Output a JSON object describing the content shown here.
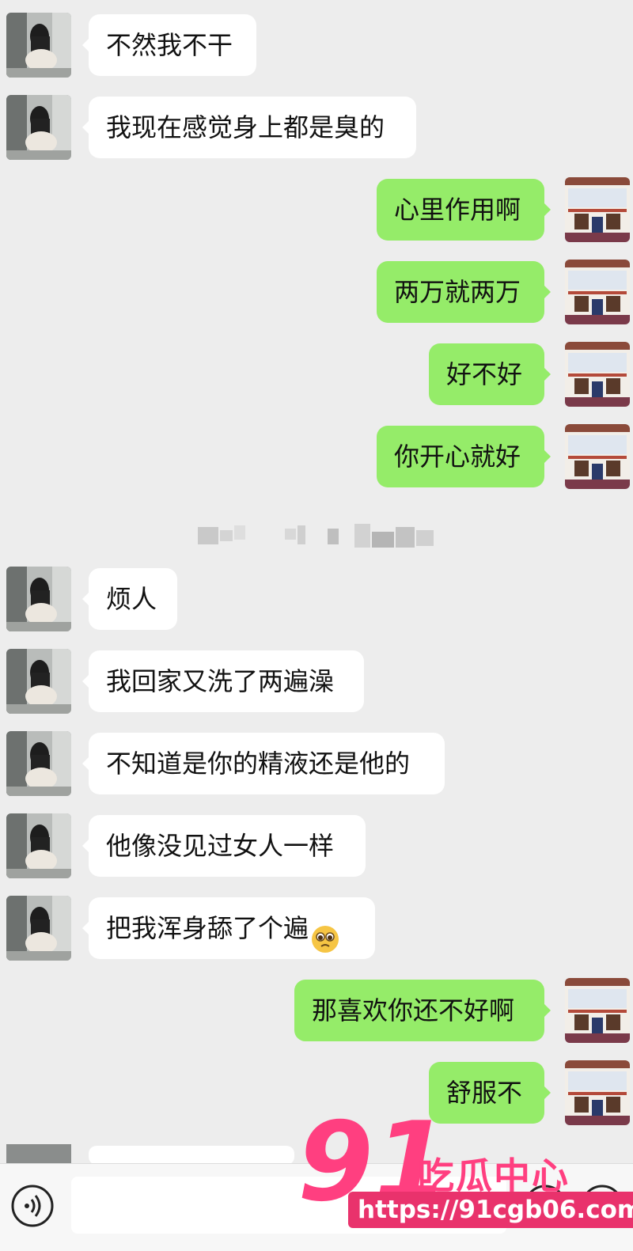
{
  "messages": [
    {
      "side": "left",
      "text": "不然我不干"
    },
    {
      "side": "left",
      "text": "我现在感觉身上都是臭的"
    },
    {
      "side": "right",
      "text": "心里作用啊"
    },
    {
      "side": "right",
      "text": "两万就两万"
    },
    {
      "side": "right",
      "text": "好不好"
    },
    {
      "side": "right",
      "text": "你开心就好"
    },
    {
      "side": "left",
      "text": "烦人"
    },
    {
      "side": "left",
      "text": "我回家又洗了两遍澡"
    },
    {
      "side": "left",
      "text": "不知道是你的精液还是他的"
    },
    {
      "side": "left",
      "text": "他像没见过女人一样"
    },
    {
      "side": "left",
      "text": "把我浑身舔了个遍",
      "emoji": "pleading-face-emoji"
    },
    {
      "side": "right",
      "text": "那喜欢你还不好啊"
    },
    {
      "side": "right",
      "text": "舒服不"
    }
  ],
  "input_bar": {
    "voice_icon": "voice-icon",
    "emoji_icon": "emoji-face-icon",
    "plus_icon": "plus-icon"
  },
  "watermark": {
    "logo_number": "91",
    "logo_text": "吃瓜中心",
    "url": "https://91cgb06.com"
  },
  "colors": {
    "background": "#ededed",
    "sent_bubble": "#95ec69",
    "received_bubble": "#ffffff",
    "watermark": "#ff3f80"
  }
}
